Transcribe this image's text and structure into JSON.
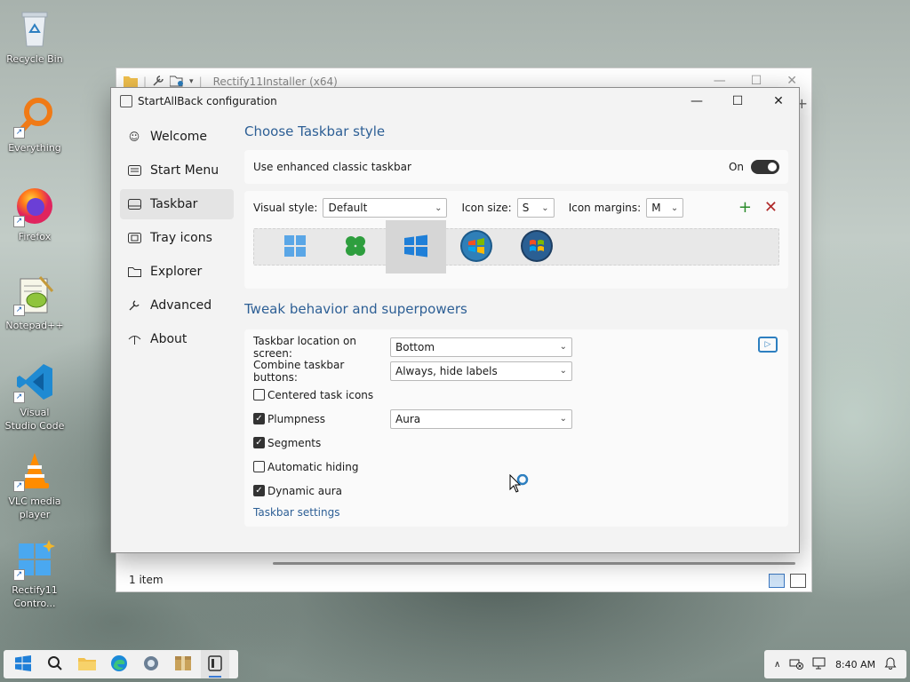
{
  "desktop": {
    "icons": [
      {
        "label": "Recycle Bin",
        "icon": "recycle-bin-icon"
      },
      {
        "label": "Everything",
        "icon": "everything-search-icon"
      },
      {
        "label": "Firefox",
        "icon": "firefox-icon"
      },
      {
        "label": "Notepad++",
        "icon": "notepad-plus-plus-icon"
      },
      {
        "label": "Visual Studio Code",
        "icon": "vscode-icon"
      },
      {
        "label": "VLC media player",
        "icon": "vlc-icon"
      },
      {
        "label": "Rectify11 Contro...",
        "icon": "rectify11-icon"
      }
    ]
  },
  "explorer": {
    "title": "Rectify11Installer (x64)",
    "status": "1 item"
  },
  "sab": {
    "title": "StartAllBack configuration",
    "nav": [
      {
        "label": "Welcome",
        "icon": "smiley-icon",
        "active": false
      },
      {
        "label": "Start Menu",
        "icon": "start-menu-icon",
        "active": false
      },
      {
        "label": "Taskbar",
        "icon": "taskbar-icon",
        "active": true
      },
      {
        "label": "Tray icons",
        "icon": "tray-icon",
        "active": false
      },
      {
        "label": "Explorer",
        "icon": "folder-icon",
        "active": false
      },
      {
        "label": "Advanced",
        "icon": "wrench-icon",
        "active": false
      },
      {
        "label": "About",
        "icon": "about-icon",
        "active": false
      }
    ],
    "taskbar_style": {
      "heading": "Choose Taskbar style",
      "enhanced_label": "Use enhanced classic taskbar",
      "toggle_state": "On",
      "visual_style_label": "Visual style:",
      "visual_style_value": "Default",
      "icon_size_label": "Icon size:",
      "icon_size_value": "S",
      "icon_margins_label": "Icon margins:",
      "icon_margins_value": "M",
      "style_options": [
        "windows-11-start-icon",
        "clover-start-icon",
        "windows-10-start-icon",
        "windows-7-orb-icon",
        "windows-vista-orb-icon"
      ],
      "selected_style_index": 2
    },
    "tweaks": {
      "heading": "Tweak behavior and superpowers",
      "location_label": "Taskbar location on screen:",
      "location_value": "Bottom",
      "combine_label": "Combine taskbar buttons:",
      "combine_value": "Always, hide labels",
      "centered_label": "Centered task icons",
      "centered_checked": false,
      "plumpness_label": "Plumpness",
      "plumpness_checked": true,
      "plumpness_value": "Aura",
      "segments_label": "Segments",
      "segments_checked": true,
      "autohide_label": "Automatic hiding",
      "autohide_checked": false,
      "dynamic_aura_label": "Dynamic aura",
      "dynamic_aura_checked": true,
      "settings_link": "Taskbar settings"
    }
  },
  "taskbar": {
    "time": "8:40 AM",
    "pinned": [
      "start-icon",
      "search-icon",
      "file-explorer-icon",
      "edge-icon",
      "settings-icon",
      "package-icon",
      "startallback-icon"
    ]
  }
}
